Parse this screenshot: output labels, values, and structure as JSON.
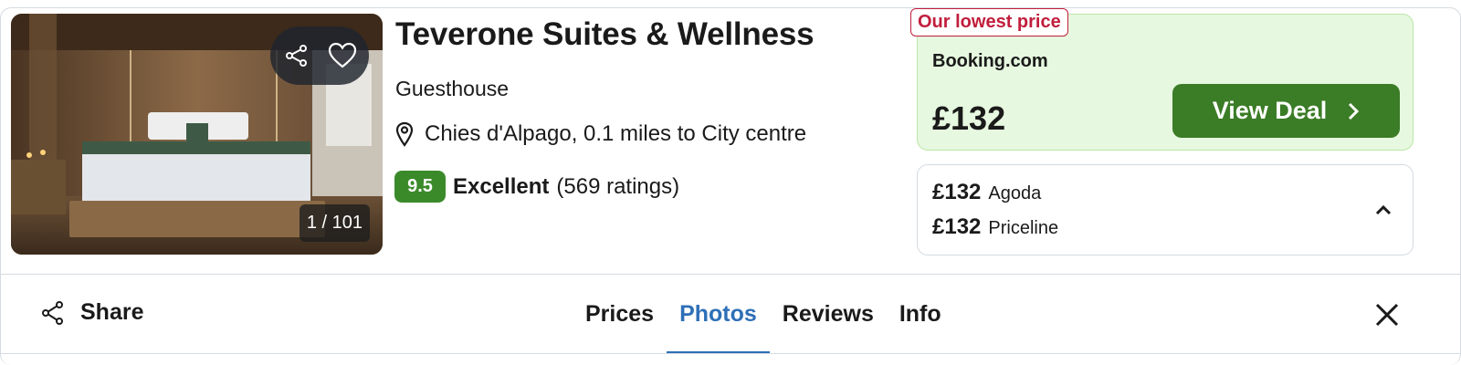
{
  "hotel": {
    "name": "Teverone Suites & Wellness",
    "type": "Guesthouse",
    "location": "Chies d'Alpago, 0.1 miles to City centre",
    "score": "9.5",
    "rating_label": "Excellent",
    "rating_count": "(569 ratings)"
  },
  "photo": {
    "counter": "1 / 101",
    "icons": [
      "share-icon",
      "heart-icon"
    ]
  },
  "best_deal": {
    "badge": "Our lowest price",
    "provider": "Booking.com",
    "price": "£132",
    "button_label": "View Deal"
  },
  "other_prices": [
    {
      "price": "£132",
      "provider": "Agoda"
    },
    {
      "price": "£132",
      "provider": "Priceline"
    }
  ],
  "bottom_bar": {
    "share_label": "Share",
    "tabs": [
      "Prices",
      "Photos",
      "Reviews",
      "Info"
    ],
    "active_tab": "Photos"
  },
  "colors": {
    "score_bg": "#3b8a2a",
    "deal_bg": "#e6f8df",
    "button_bg": "#3b7c26",
    "badge_red": "#c11e3c",
    "active_tab": "#2e6fb7"
  }
}
